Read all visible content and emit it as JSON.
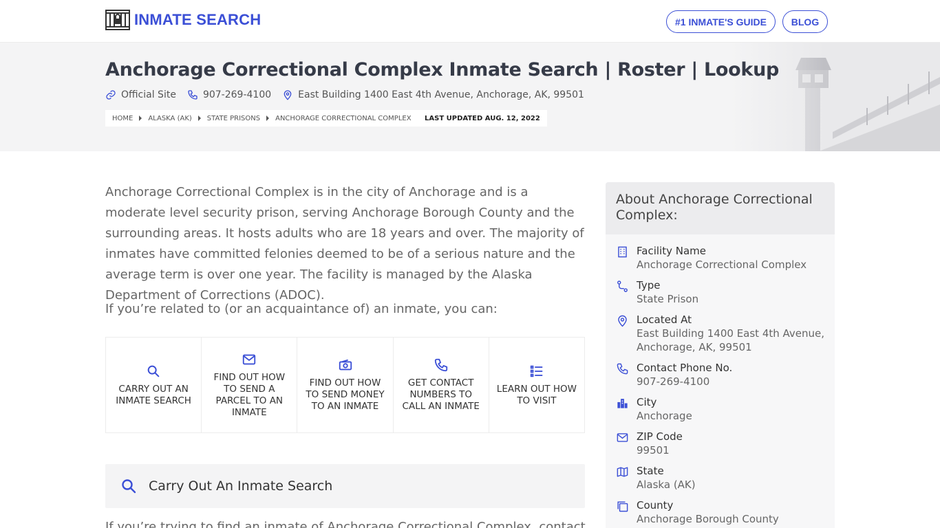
{
  "header": {
    "logo_text": "INMATE SEARCH",
    "nav": [
      {
        "label": "#1 INMATE'S GUIDE"
      },
      {
        "label": "BLOG"
      }
    ]
  },
  "hero": {
    "title": "Anchorage Correctional Complex Inmate Search | Roster | Lookup",
    "official_site": "Official Site",
    "phone": "907-269-4100",
    "address": "East Building 1400 East 4th Avenue, Anchorage, AK, 99501",
    "breadcrumbs": [
      "HOME",
      "ALASKA (AK)",
      "STATE PRISONS",
      "ANCHORAGE CORRECTIONAL COMPLEX"
    ],
    "last_updated": "LAST UPDATED AUG. 12, 2022"
  },
  "main": {
    "intro": "Anchorage Correctional Complex is in the city of Anchorage and is a moderate level security prison, serving Anchorage Borough County and the surrounding areas. It hosts adults who are 18 years and over. The majority of inmates have committed felonies deemed to be of a serious nature and the average term is over one year. The facility is managed by the Alaska Department of Corrections (ADOC).",
    "related": "If you’re related to (or an acquaintance of) an inmate, you can:",
    "cards": [
      {
        "label": "CARRY OUT AN INMATE SEARCH",
        "icon": "search-icon"
      },
      {
        "label": "FIND OUT HOW TO SEND A PARCEL TO AN INMATE",
        "icon": "envelope-icon"
      },
      {
        "label": "FIND OUT HOW TO SEND MONEY TO AN INMATE",
        "icon": "money-icon"
      },
      {
        "label": "GET CONTACT NUMBERS TO CALL AN INMATE",
        "icon": "phone-icon"
      },
      {
        "label": "LEARN OUT HOW TO VISIT",
        "icon": "list-icon"
      }
    ],
    "section_title": "Carry Out An Inmate Search",
    "section_text": "If you’re trying to find an inmate of Anchorage Correctional Complex, contact them"
  },
  "sidebar": {
    "title": "About Anchorage Correctional Complex:",
    "facts": [
      {
        "label": "Facility Name",
        "value": "Anchorage Correctional Complex",
        "icon": "building-icon"
      },
      {
        "label": "Type",
        "value": "State Prison",
        "icon": "route-icon"
      },
      {
        "label": "Located At",
        "value": "East Building 1400 East 4th Avenue, Anchorage, AK, 99501",
        "icon": "map-pin-icon"
      },
      {
        "label": "Contact Phone No.",
        "value": "907-269-4100",
        "icon": "phone-icon"
      },
      {
        "label": "City",
        "value": "Anchorage",
        "icon": "city-icon"
      },
      {
        "label": "ZIP Code",
        "value": "99501",
        "icon": "envelope-icon"
      },
      {
        "label": "State",
        "value": "Alaska (AK)",
        "icon": "map-icon"
      },
      {
        "label": "County",
        "value": "Anchorage Borough County",
        "icon": "copy-icon"
      }
    ]
  },
  "colors": {
    "accent": "#3b4fd6",
    "hero_bg": "#f4f4f5",
    "text": "#666666"
  }
}
